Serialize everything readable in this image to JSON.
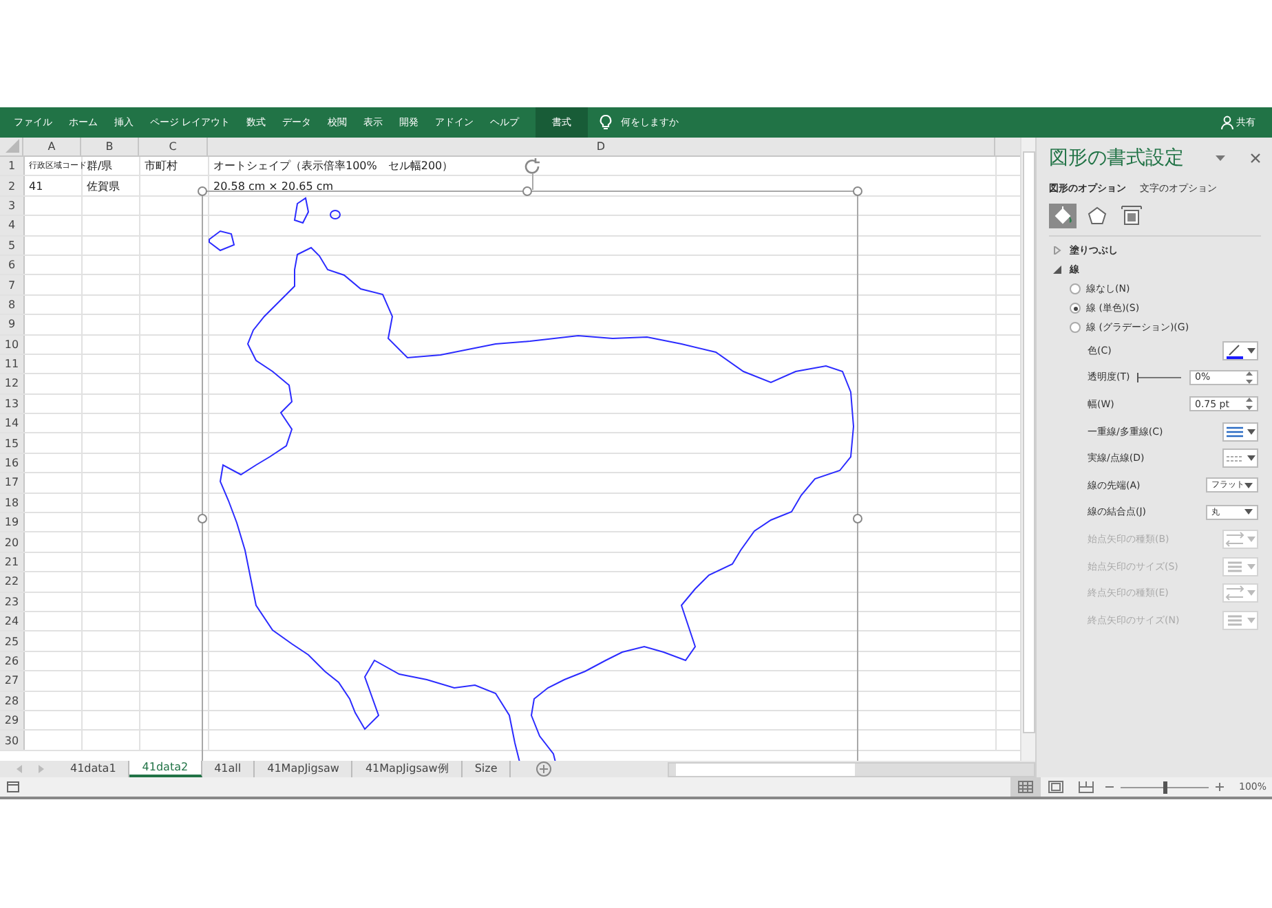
{
  "ribbon": {
    "tabs": [
      {
        "label": "ファイル",
        "selected": false
      },
      {
        "label": "ホーム",
        "selected": false
      },
      {
        "label": "挿入",
        "selected": false
      },
      {
        "label": "ページ レイアウト",
        "selected": false
      },
      {
        "label": "数式",
        "selected": false
      },
      {
        "label": "データ",
        "selected": false
      },
      {
        "label": "校閲",
        "selected": false
      },
      {
        "label": "表示",
        "selected": false
      },
      {
        "label": "開発",
        "selected": false
      },
      {
        "label": "アドイン",
        "selected": false
      },
      {
        "label": "ヘルプ",
        "selected": false
      },
      {
        "label": "書式",
        "selected": true
      }
    ],
    "tell_me": "何をしますか",
    "share": "共有"
  },
  "sheet": {
    "columns": [
      "A",
      "B",
      "C",
      "D"
    ],
    "rows": [
      {
        "number": "1",
        "cells": [
          "行政区域コード",
          "群/県",
          "市町村",
          "オートシェイプ（表示倍率100%　セル幅200）"
        ]
      },
      {
        "number": "2",
        "cells": [
          "41",
          "佐賀県",
          "",
          "20.58 cm × 20.65 cm"
        ]
      },
      {
        "number": "3",
        "cells": []
      },
      {
        "number": "4",
        "cells": []
      },
      {
        "number": "5",
        "cells": []
      },
      {
        "number": "6",
        "cells": []
      },
      {
        "number": "7",
        "cells": []
      },
      {
        "number": "8",
        "cells": []
      },
      {
        "number": "9",
        "cells": []
      },
      {
        "number": "10",
        "cells": []
      },
      {
        "number": "11",
        "cells": []
      },
      {
        "number": "12",
        "cells": []
      },
      {
        "number": "13",
        "cells": []
      },
      {
        "number": "14",
        "cells": []
      },
      {
        "number": "15",
        "cells": []
      },
      {
        "number": "16",
        "cells": []
      },
      {
        "number": "17",
        "cells": []
      },
      {
        "number": "18",
        "cells": []
      },
      {
        "number": "19",
        "cells": []
      },
      {
        "number": "20",
        "cells": []
      },
      {
        "number": "21",
        "cells": []
      },
      {
        "number": "22",
        "cells": []
      },
      {
        "number": "23",
        "cells": []
      },
      {
        "number": "24",
        "cells": []
      },
      {
        "number": "25",
        "cells": []
      },
      {
        "number": "26",
        "cells": []
      },
      {
        "number": "27",
        "cells": []
      },
      {
        "number": "28",
        "cells": []
      },
      {
        "number": "29",
        "cells": []
      },
      {
        "number": "30",
        "cells": []
      }
    ]
  },
  "sheet_tabs": [
    {
      "label": "41data1",
      "selected": false
    },
    {
      "label": "41data2",
      "selected": true
    },
    {
      "label": "41all",
      "selected": false
    },
    {
      "label": "41MapJigsaw",
      "selected": false
    },
    {
      "label": "41MapJigsaw例",
      "selected": false
    },
    {
      "label": "Size",
      "selected": false
    }
  ],
  "panel": {
    "title": "図形の書式設定",
    "option_tabs": [
      {
        "label": "図形のオプション",
        "selected": true
      },
      {
        "label": "文字のオプション",
        "selected": false
      }
    ],
    "icon_tabs": [
      {
        "kind": "fill",
        "selected": true
      },
      {
        "kind": "shape",
        "selected": false
      },
      {
        "kind": "size",
        "selected": false
      }
    ],
    "sections": [
      {
        "label": "塗りつぶし",
        "expanded": false
      },
      {
        "label": "線",
        "expanded": true
      }
    ],
    "line_types": [
      {
        "label": "線なし(N)",
        "selected": false
      },
      {
        "label": "線 (単色)(S)",
        "selected": true
      },
      {
        "label": "線 (グラデーション)(G)",
        "selected": false
      }
    ],
    "properties": [
      {
        "kind": "color",
        "label": "色(C)",
        "disabled": false
      },
      {
        "kind": "slider",
        "label": "透明度(T)",
        "level": 0,
        "value": "0%",
        "disabled": false
      },
      {
        "kind": "spin",
        "label": "幅(W)",
        "value": "0.75 pt",
        "disabled": false
      },
      {
        "kind": "compound",
        "label": "一重線/多重線(C)",
        "disabled": false
      },
      {
        "kind": "dash",
        "label": "実線/点線(D)",
        "disabled": false
      },
      {
        "kind": "select",
        "label": "線の先端(A)",
        "value": "フラット",
        "disabled": false
      },
      {
        "kind": "select",
        "label": "線の結合点(J)",
        "value": "丸",
        "disabled": false
      },
      {
        "kind": "arrow",
        "label": "始点矢印の種類(B)",
        "disabled": true
      },
      {
        "kind": "arrowsize",
        "label": "始点矢印のサイズ(S)",
        "disabled": true
      },
      {
        "kind": "arrow",
        "label": "終点矢印の種類(E)",
        "disabled": true
      },
      {
        "kind": "arrowsize",
        "label": "終点矢印のサイズ(N)",
        "disabled": true
      }
    ]
  },
  "status_bar": {
    "views": [
      {
        "kind": "normal",
        "selected": true
      },
      {
        "kind": "layout",
        "selected": false
      },
      {
        "kind": "pagebreak",
        "selected": false
      }
    ],
    "zoom": {
      "level": 0.5,
      "reading": "100%"
    }
  }
}
